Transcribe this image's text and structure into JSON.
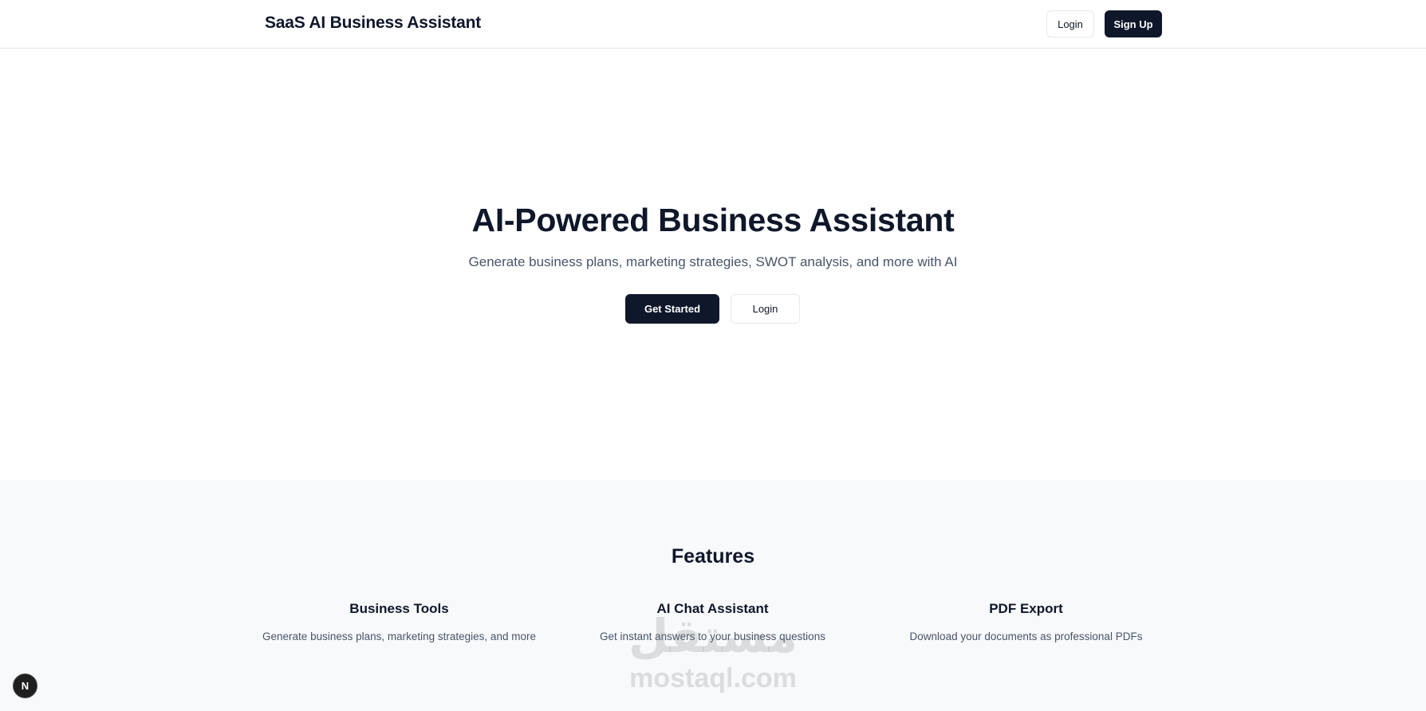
{
  "navbar": {
    "brand": "SaaS AI Business Assistant",
    "login_label": "Login",
    "signup_label": "Sign Up"
  },
  "hero": {
    "title": "AI-Powered Business Assistant",
    "subtitle": "Generate business plans, marketing strategies, SWOT analysis, and more with AI",
    "primary_button": "Get Started",
    "secondary_button": "Login"
  },
  "features": {
    "heading": "Features",
    "items": [
      {
        "title": "Business Tools",
        "description": "Generate business plans, marketing strategies, and more"
      },
      {
        "title": "AI Chat Assistant",
        "description": "Get instant answers to your business questions"
      },
      {
        "title": "PDF Export",
        "description": "Download your documents as professional PDFs"
      }
    ]
  },
  "watermark": {
    "logo": "مستقل",
    "text": "mostaql.com"
  },
  "dev_badge": {
    "label": "N"
  },
  "colors": {
    "primary_dark": "#0f172a",
    "muted_text": "#475569",
    "border": "#e5e7eb",
    "features_bg": "#f8f9fb"
  }
}
